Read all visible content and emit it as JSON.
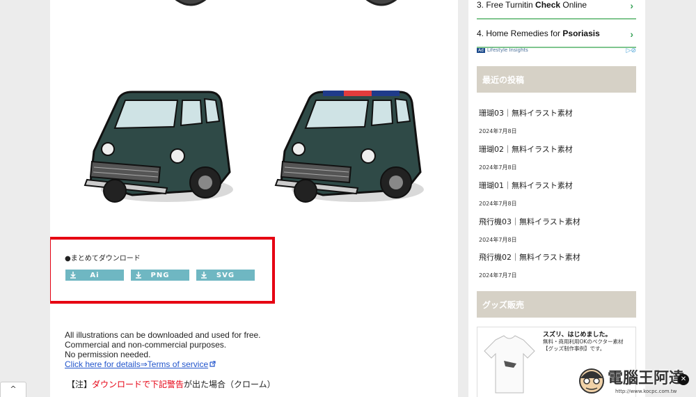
{
  "download": {
    "title": "●まとめてダウンロード",
    "buttons": [
      {
        "label": "Ai"
      },
      {
        "label": "PNG"
      },
      {
        "label": "SVG"
      }
    ]
  },
  "info": {
    "line1": "All illustrations can be downloaded and used for free.",
    "line2": "Commercial and non-commercial purposes.",
    "line3": "No permission needed.",
    "link": "Click here for details⇒Terms of service"
  },
  "note": {
    "prefix": "【注】",
    "red": "ダウンロードで下記警告",
    "suffix": "が出た場合（クローム）"
  },
  "ads": {
    "item3_num": "3. Free Turnitin ",
    "item3_bold": "Check",
    "item3_rest": " Online",
    "item4_num": "4. Home Remedies for ",
    "item4_bold": "Psoriasis",
    "badge": "Ad",
    "source": "Lifestyle Insights"
  },
  "recent": {
    "heading": "最近の投稿",
    "posts": [
      {
        "title": "珊瑚03｜無料イラスト素材",
        "date": "2024年7月8日"
      },
      {
        "title": "珊瑚02｜無料イラスト素材",
        "date": "2024年7月8日"
      },
      {
        "title": "珊瑚01｜無料イラスト素材",
        "date": "2024年7月8日"
      },
      {
        "title": "飛行機03｜無料イラスト素材",
        "date": "2024年7月8日"
      },
      {
        "title": "飛行機02｜無料イラスト素材",
        "date": "2024年7月7日"
      }
    ]
  },
  "goods": {
    "heading": "グッズ販売",
    "title": "スズリ、はじめました。",
    "desc": "無料・商用利用OKのベクター素材【グッズ制作事例】です。"
  },
  "watermark": {
    "text": "電腦王阿達",
    "url": "http://www.kocpc.com.tw"
  },
  "ui": {
    "collapse": "^"
  },
  "colors": {
    "button": "#6fb7c2",
    "highlight": "#e60012",
    "sidebar_heading": "#d6d1c6",
    "car_body": "#2f4a47"
  }
}
